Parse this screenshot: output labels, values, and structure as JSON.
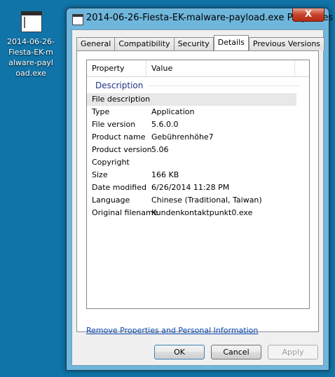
{
  "desktop": {
    "icon_label": "2014-06-26-Fiesta-EK-malware-payload.exe"
  },
  "window": {
    "title": "2014-06-26-Fiesta-EK-malware-payload.exe Properties",
    "close_label": "X"
  },
  "tabs": [
    {
      "label": "General",
      "active": false
    },
    {
      "label": "Compatibility",
      "active": false
    },
    {
      "label": "Security",
      "active": false
    },
    {
      "label": "Details",
      "active": true
    },
    {
      "label": "Previous Versions",
      "active": false
    }
  ],
  "details": {
    "columns": {
      "property": "Property",
      "value": "Value"
    },
    "group": "Description",
    "rows": [
      {
        "property": "File description",
        "value": ""
      },
      {
        "property": "Type",
        "value": "Application"
      },
      {
        "property": "File version",
        "value": "5.6.0.0"
      },
      {
        "property": "Product name",
        "value": "Gebührenhöhe7"
      },
      {
        "property": "Product version",
        "value": "5.06"
      },
      {
        "property": "Copyright",
        "value": ""
      },
      {
        "property": "Size",
        "value": "166 KB"
      },
      {
        "property": "Date modified",
        "value": "6/26/2014 11:28 PM"
      },
      {
        "property": "Language",
        "value": "Chinese (Traditional, Taiwan)"
      },
      {
        "property": "Original filename",
        "value": "Kundenkontaktpunkt0.exe"
      }
    ]
  },
  "link": {
    "remove_properties": "Remove Properties and Personal Information"
  },
  "buttons": {
    "ok": "OK",
    "cancel": "Cancel",
    "apply": "Apply"
  },
  "colors": {
    "desktop_bg": "#1074a8",
    "window_frame": "#6fb6dc",
    "close_button": "#c7432b",
    "group_header": "#1e3287",
    "link": "#0645ad"
  }
}
